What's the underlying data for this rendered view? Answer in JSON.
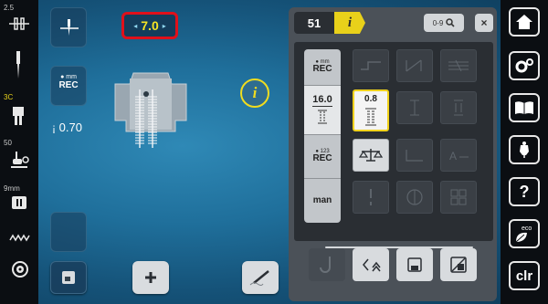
{
  "left_bar": {
    "stitch_width_label": "2.5",
    "foot_label": "3C",
    "tension_label": "50",
    "buttonhole_label": "9mm"
  },
  "main": {
    "rec_top": "mm",
    "rec_label": "REC",
    "stitch_width_value": "7.0",
    "needle_position": "0.70",
    "info_label": "i"
  },
  "panel": {
    "stitch_number": "51",
    "info_tab": "i",
    "search_label": "0-9",
    "close_label": "×",
    "tabs": [
      {
        "top": "mm",
        "label": "REC"
      },
      {
        "top": "",
        "label": "16.0"
      },
      {
        "top": "123",
        "label": "REC"
      },
      {
        "top": "",
        "label": "man"
      }
    ],
    "selected_value": "0.8"
  },
  "right_bar": {
    "clr_label": "clr",
    "help_label": "?",
    "eco_label": "eco"
  },
  "colors": {
    "accent_yellow": "#f0d21c",
    "highlight_red": "#e0101a"
  }
}
